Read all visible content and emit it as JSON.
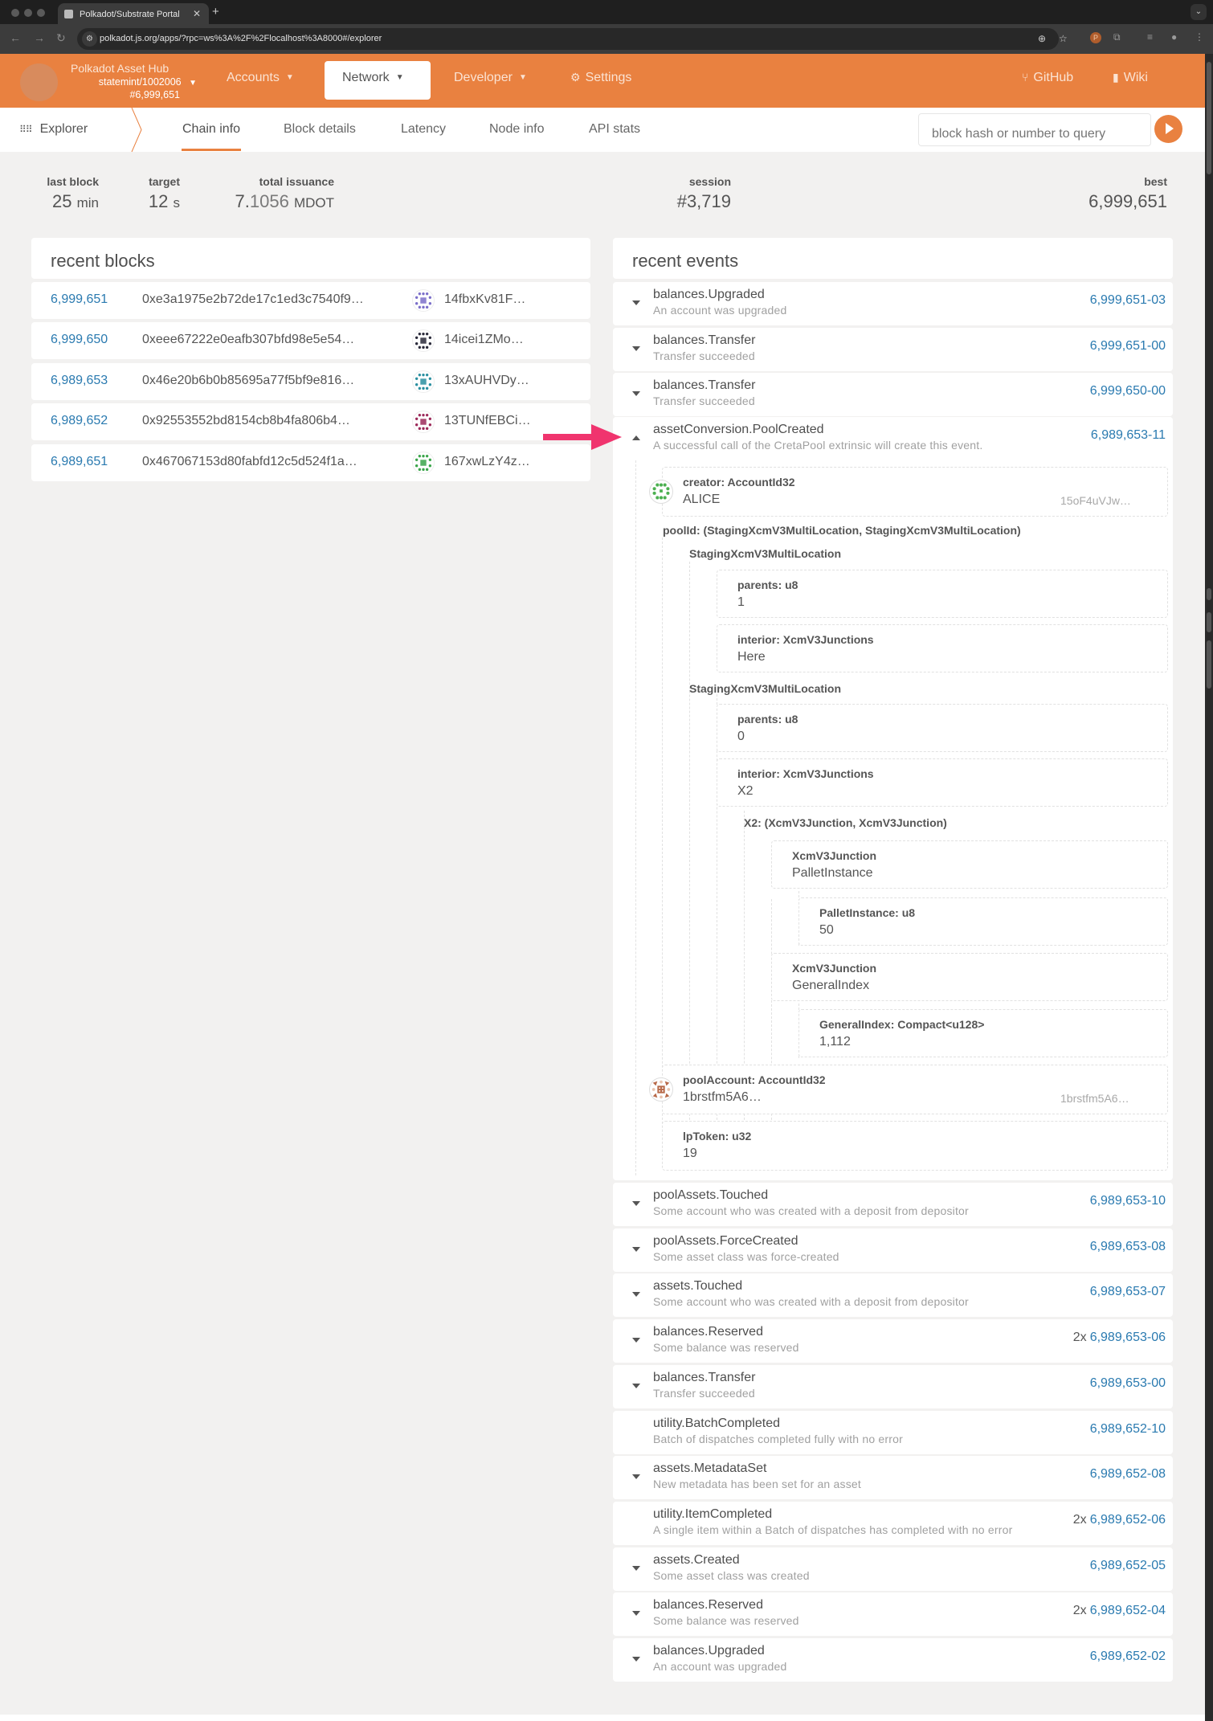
{
  "browser": {
    "tab_title": "Polkadot/Substrate Portal",
    "url": "polkadot.js.org/apps/?rpc=ws%3A%2F%2Flocalhost%3A8000#/explorer"
  },
  "header": {
    "chain_name": "Polkadot Asset Hub",
    "chain_spec": "statemint/1002006",
    "chain_block": "#6,999,651",
    "menus": [
      "Accounts",
      "Network",
      "Developer",
      "Settings"
    ],
    "links": [
      "GitHub",
      "Wiki"
    ]
  },
  "subnav": {
    "app": "Explorer",
    "tabs": [
      "Chain info",
      "Block details",
      "Latency",
      "Node info",
      "API stats"
    ],
    "active_tab": "Chain info",
    "search_placeholder": "block hash or number to query"
  },
  "stats": {
    "last_block": {
      "label": "last block",
      "value": "25",
      "unit": "min"
    },
    "target": {
      "label": "target",
      "value": "12",
      "unit": "s"
    },
    "total_issuance": {
      "label": "total issuance",
      "int": "7.",
      "frac": "1056",
      "unit": "MDOT"
    },
    "session": {
      "label": "session",
      "value": "#3,719"
    },
    "best": {
      "label": "best",
      "value": "6,999,651"
    }
  },
  "recent_blocks": {
    "title": "recent blocks",
    "rows": [
      {
        "number": "6,999,651",
        "hash": "0xe3a1975e2b72de17c1ed3c7540f9…",
        "author": "14fbxKv81F…",
        "color": "#7b6fc9"
      },
      {
        "number": "6,999,650",
        "hash": "0xeee67222e0eafb307bfd98e5e54…",
        "author": "14icei1ZMo…",
        "color": "#2a2a3a"
      },
      {
        "number": "6,989,653",
        "hash": "0x46e20b6b0b85695a77f5bf9e816…",
        "author": "13xAUHVDy…",
        "color": "#2a8fa0"
      },
      {
        "number": "6,989,652",
        "hash": "0x92553552bd8154cb8b4fa806b4…",
        "author": "13TUNfEBCi…",
        "color": "#9c2a5a"
      },
      {
        "number": "6,989,651",
        "hash": "0x467067153d80fabfd12c5d524f1a…",
        "author": "167xwLzY4z…",
        "color": "#3aa54a"
      }
    ]
  },
  "recent_events": {
    "title": "recent events",
    "top": [
      {
        "name": "balances.Upgraded",
        "desc": "An account was upgraded",
        "index": "6,999,651-03",
        "count": ""
      },
      {
        "name": "balances.Transfer",
        "desc": "Transfer succeeded",
        "index": "6,999,651-00",
        "count": ""
      },
      {
        "name": "balances.Transfer",
        "desc": "Transfer succeeded",
        "index": "6,999,650-00",
        "count": ""
      }
    ],
    "expanded": {
      "name": "assetConversion.PoolCreated",
      "desc": "A successful call of the CretaPool extrinsic will create this event.",
      "index": "6,989,653-11",
      "creator": {
        "label": "creator: AccountId32",
        "value": "ALICE",
        "address": "15oF4uVJw…"
      },
      "pool_id_label": "poolId: (StagingXcmV3MultiLocation, StagingXcmV3MultiLocation)",
      "loc1": {
        "label": "StagingXcmV3MultiLocation",
        "parents": {
          "label": "parents: u8",
          "value": "1"
        },
        "interior": {
          "label": "interior: XcmV3Junctions",
          "value": "Here"
        }
      },
      "loc2": {
        "label": "StagingXcmV3MultiLocation",
        "parents": {
          "label": "parents: u8",
          "value": "0"
        },
        "interior": {
          "label": "interior: XcmV3Junctions",
          "value": "X2"
        },
        "x2_label": "X2: (XcmV3Junction, XcmV3Junction)",
        "j1": {
          "label": "XcmV3Junction",
          "value": "PalletInstance",
          "inner_label": "PalletInstance: u8",
          "inner_value": "50"
        },
        "j2": {
          "label": "XcmV3Junction",
          "value": "GeneralIndex",
          "inner_label": "GeneralIndex: Compact<u128>",
          "inner_value": "1,112"
        }
      },
      "pool_account": {
        "label": "poolAccount: AccountId32",
        "value": "1brstfm5A6…",
        "address": "1brstfm5A6…"
      },
      "lp_token": {
        "label": "lpToken: u32",
        "value": "19"
      }
    },
    "bottom": [
      {
        "name": "poolAssets.Touched",
        "desc": "Some account who was created with a deposit from depositor",
        "index": "6,989,653-10",
        "count": "",
        "toggle": true
      },
      {
        "name": "poolAssets.ForceCreated",
        "desc": "Some asset class was force-created",
        "index": "6,989,653-08",
        "count": "",
        "toggle": true
      },
      {
        "name": "assets.Touched",
        "desc": "Some account who was created with a deposit from depositor",
        "index": "6,989,653-07",
        "count": "",
        "toggle": true
      },
      {
        "name": "balances.Reserved",
        "desc": "Some balance was reserved",
        "index": "6,989,653-06",
        "count": "2x",
        "toggle": true
      },
      {
        "name": "balances.Transfer",
        "desc": "Transfer succeeded",
        "index": "6,989,653-00",
        "count": "",
        "toggle": true
      },
      {
        "name": "utility.BatchCompleted",
        "desc": "Batch of dispatches completed fully with no error",
        "index": "6,989,652-10",
        "count": "",
        "toggle": false
      },
      {
        "name": "assets.MetadataSet",
        "desc": "New metadata has been set for an asset",
        "index": "6,989,652-08",
        "count": "",
        "toggle": true
      },
      {
        "name": "utility.ItemCompleted",
        "desc": "A single item within a Batch of dispatches has completed with no error",
        "index": "6,989,652-06",
        "count": "2x",
        "toggle": false
      },
      {
        "name": "assets.Created",
        "desc": "Some asset class was created",
        "index": "6,989,652-05",
        "count": "",
        "toggle": true
      },
      {
        "name": "balances.Reserved",
        "desc": "Some balance was reserved",
        "index": "6,989,652-04",
        "count": "2x",
        "toggle": true
      },
      {
        "name": "balances.Upgraded",
        "desc": "An account was upgraded",
        "index": "6,989,652-02",
        "count": "",
        "toggle": true
      }
    ]
  },
  "colors": {
    "brand": "#e98140",
    "link": "#2a7ab0",
    "annotation_arrow": "#f0346e"
  }
}
